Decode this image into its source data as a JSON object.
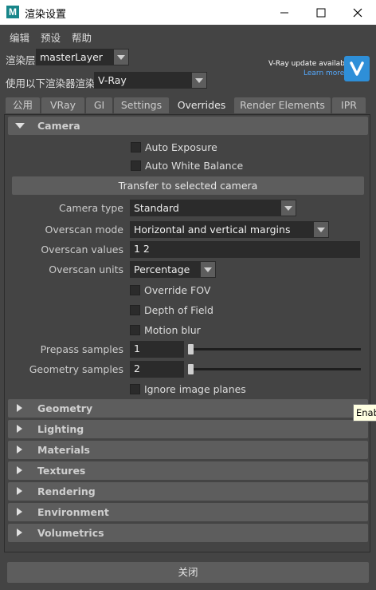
{
  "window": {
    "title": "渲染设置",
    "logo_letter": "M",
    "controls": [
      "minimize",
      "maximize",
      "close"
    ]
  },
  "menu": [
    "编辑",
    "预设",
    "帮助"
  ],
  "render_layer": {
    "label": "渲染层",
    "value": "masterLayer"
  },
  "renderer": {
    "label": "使用以下渲染器渲染",
    "value": "V-Ray"
  },
  "vray_update": {
    "text": "V-Ray update available",
    "link": "Learn more"
  },
  "tabs": [
    {
      "label": "公用",
      "active": false
    },
    {
      "label": "VRay",
      "active": false
    },
    {
      "label": "GI",
      "active": false
    },
    {
      "label": "Settings",
      "active": false
    },
    {
      "label": "Overrides",
      "active": true
    },
    {
      "label": "Render Elements",
      "active": false
    },
    {
      "label": "IPR",
      "active": false
    }
  ],
  "camera_section": {
    "title": "Camera",
    "expanded": true,
    "auto_exposure": "Auto Exposure",
    "auto_white_balance": "Auto White Balance",
    "transfer_button": "Transfer to selected camera",
    "camera_type": {
      "label": "Camera type",
      "value": "Standard"
    },
    "overscan_mode": {
      "label": "Overscan mode",
      "value": "Horizontal and vertical margins"
    },
    "overscan_values": {
      "label": "Overscan values",
      "value": "1 2"
    },
    "overscan_units": {
      "label": "Overscan units",
      "value": "Percentage"
    },
    "override_fov": "Override FOV",
    "depth_of_field": "Depth of Field",
    "motion_blur": "Motion blur",
    "prepass_samples": {
      "label": "Prepass samples",
      "value": "1"
    },
    "geometry_samples": {
      "label": "Geometry samples",
      "value": "2"
    },
    "ignore_image_planes": "Ignore image planes"
  },
  "collapsed_sections": [
    "Geometry",
    "Lighting",
    "Materials",
    "Textures",
    "Rendering",
    "Environment",
    "Volumetrics"
  ],
  "tooltip": "Enab",
  "close_button": "关闭",
  "colors": {
    "background": "#444444",
    "frame": "#5d5d5d",
    "field": "#2b2b2b",
    "accent_link": "#55aaff",
    "vray_blue": "#2e8fd8"
  }
}
